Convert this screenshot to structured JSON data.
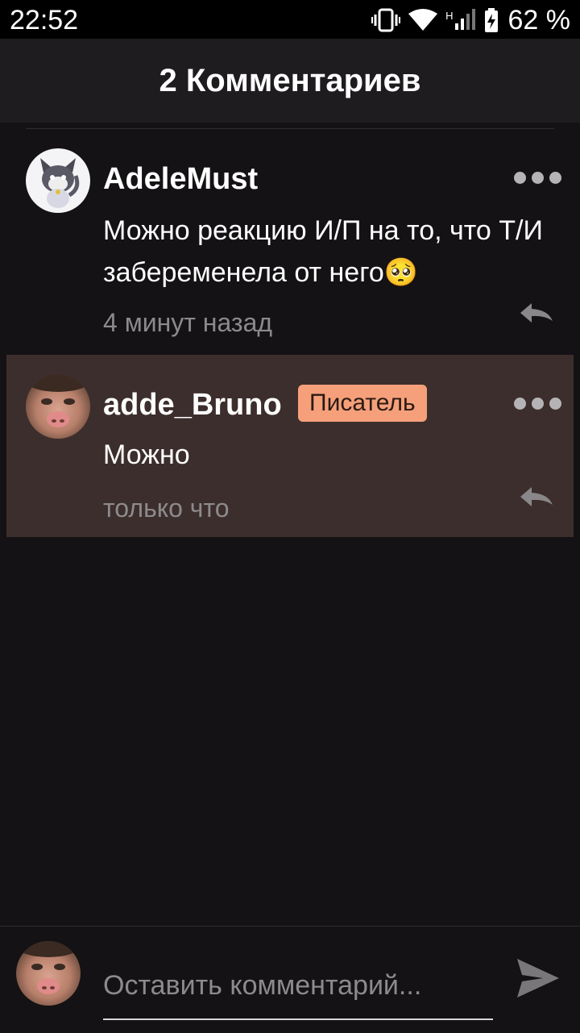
{
  "status_bar": {
    "time": "22:52",
    "battery": "62 %",
    "network_label": "H"
  },
  "header": {
    "title": "2 Комментариев"
  },
  "comments": [
    {
      "username": "AdeleMust",
      "badge": "",
      "text": "Можно реакцию И/П на то, что Т/И забеременела от него🥺",
      "time": "4 минут назад",
      "avatar_icon": "cat-avatar"
    },
    {
      "username": "adde_Bruno",
      "badge": "Писатель",
      "text": "Можно",
      "time": "только что",
      "avatar_icon": "face-avatar"
    }
  ],
  "composer": {
    "placeholder": "Оставить комментарий...",
    "send_icon": "send-icon"
  },
  "colors": {
    "background": "#141214",
    "highlight": "#3c2e2c",
    "badge": "#f5a07a"
  }
}
